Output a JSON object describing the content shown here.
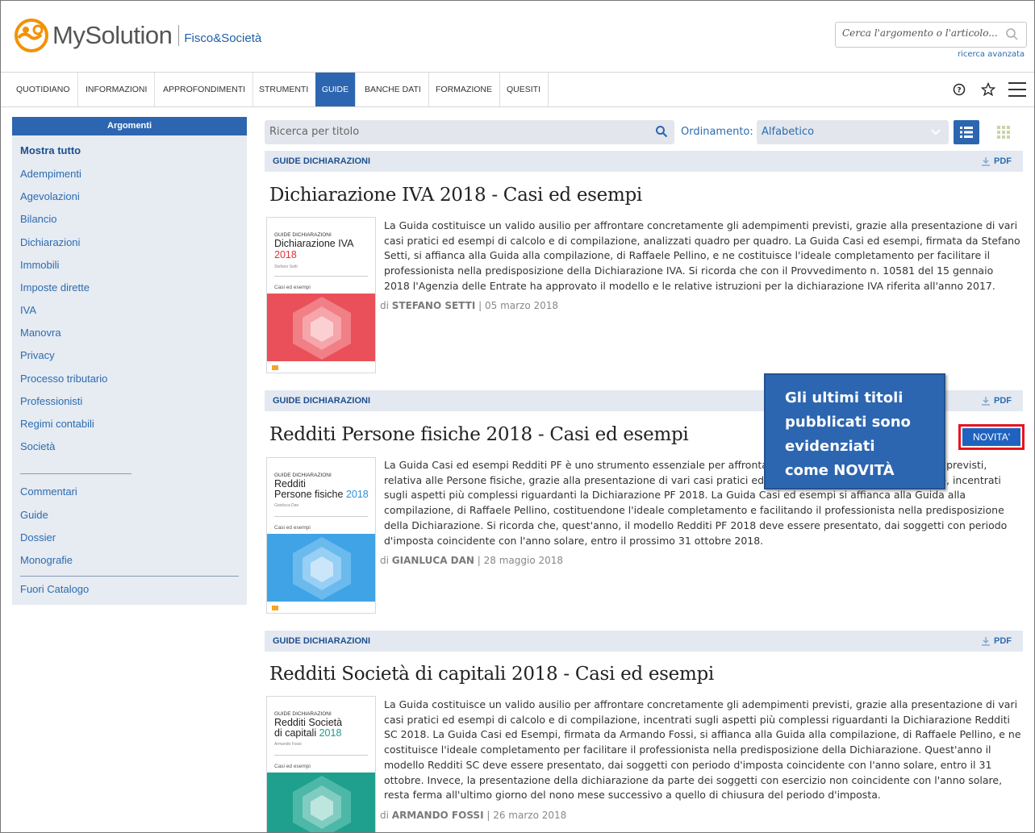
{
  "brand": {
    "name": "MySolution",
    "sub": "Fisco&Società"
  },
  "search": {
    "placeholder": "Cerca l'argomento o l'articolo...",
    "advanced": "ricerca avanzata"
  },
  "nav": {
    "items": [
      "QUOTIDIANO",
      "INFORMAZIONI",
      "APPROFONDIMENTI",
      "STRUMENTI",
      "GUIDE",
      "BANCHE DATI",
      "FORMAZIONE",
      "QUESITI"
    ],
    "active": "GUIDE"
  },
  "sidebar": {
    "title": "Argomenti",
    "items": [
      "Mostra tutto",
      "Adempimenti",
      "Agevolazioni",
      "Bilancio",
      "Dichiarazioni",
      "Immobili",
      "Imposte dirette",
      "IVA",
      "Manovra",
      "Privacy",
      "Processo tributario",
      "Professionisti",
      "Regimi contabili",
      "Società"
    ],
    "items2": [
      "Commentari",
      "Guide",
      "Dossier",
      "Monografie"
    ],
    "extra": "Fuori Catalogo"
  },
  "toolbar": {
    "title_placeholder": "Ricerca per titolo",
    "order_label": "Ordinamento:",
    "order_value": "Alfabetico"
  },
  "articles": [
    {
      "category": "GUIDE DICHIARAZIONI",
      "pdf": "PDF",
      "title": "Dichiarazione IVA 2018 - Casi ed esempi",
      "cover": {
        "kicker": "GUIDE DICHIARAZIONI",
        "title": "Dichiarazione IVA",
        "year": "2018",
        "author": "Stefano Setti",
        "sub": "Casi ed esempi",
        "color": "#e9505a",
        "year_color": "#e0323c"
      },
      "body": "La Guida costituisce un valido ausilio per affrontare concretamente gli adempimenti previsti, grazie alla presentazione di vari casi pratici ed esempi di calcolo e di compilazione, analizzati quadro per quadro. La Guida Casi ed esempi, firmata da Stefano Setti, si affianca alla Guida alla compilazione, di Raffaele Pellino, e ne costituisce l'ideale completamento per facilitare il professionista nella predisposizione della Dichiarazione IVA. Si ricorda che con il Provvedimento n. 10581 del 15 gennaio 2018 l'Agenzia delle Entrate ha approvato il modello e le relative istruzioni per la dichiarazione IVA riferita all'anno 2017.",
      "by": "di",
      "author": "STEFANO SETTI",
      "date": "| 05 marzo 2018"
    },
    {
      "category": "GUIDE DICHIARAZIONI",
      "pdf": "PDF",
      "title": "Redditi Persone fisiche 2018 - Casi ed esempi",
      "badge": "NOVITA'",
      "cover": {
        "kicker": "GUIDE DICHIARAZIONI",
        "title": "Redditi",
        "title2": "Persone fisiche",
        "year": "2018",
        "author": "Gianluca Dan",
        "sub": "Casi ed esempi",
        "color": "#3fa3e6",
        "year_color": "#2f8fd8"
      },
      "body": "La Guida Casi ed esempi Redditi PF è uno strumento essenziale per affrontare concretamente gli adempimenti previsti, relativa alle Persone fisiche, grazie alla presentazione di vari casi pratici ed esempi di calcolo e di compilazione, incentrati sugli aspetti più complessi riguardanti la Dichiarazione PF 2018. La Guida Casi ed esempi si affianca alla Guida alla compilazione, di Raffaele Pellino, costituendone l'ideale completamento e facilitando il professionista nella predisposizione della Dichiarazione. Si ricorda che, quest'anno, il modello Redditi PF 2018 deve essere presentato, dai soggetti con periodo d'imposta coincidente con l'anno solare, entro il prossimo 31 ottobre 2018.",
      "by": "di",
      "author": "GIANLUCA DAN",
      "date": "| 28 maggio 2018"
    },
    {
      "category": "GUIDE DICHIARAZIONI",
      "pdf": "PDF",
      "title": "Redditi Società di capitali 2018 - Casi ed esempi",
      "cover": {
        "kicker": "GUIDE DICHIARAZIONI",
        "title": "Redditi Società",
        "title2": "di capitali",
        "year": "2018",
        "author": "Armando Fossi",
        "sub": "Casi ed esempi",
        "color": "#1fa08e",
        "year_color": "#16a085"
      },
      "body": "La Guida costituisce un valido ausilio per affrontare concretamente gli adempimenti previsti, grazie alla presentazione di vari casi pratici ed esempi di calcolo e di compilazione, incentrati sugli aspetti più complessi riguardanti la Dichiarazione Redditi SC 2018. La Guida Casi ed Esempi, firmata da Armando Fossi, si affianca alla Guida alla compilazione, di Raffaele Pellino, e ne costituisce l'ideale completamento per facilitare il professionista nella predisposizione della Dichiarazione. Quest'anno il modello Redditi SC deve essere presentato, dai soggetti con periodo d'imposta coincidente con l'anno solare, entro il 31 ottobre. Invece, la presentazione della dichiarazione da parte dei soggetti con esercizio non coincidente con l'anno solare, resta ferma all'ultimo giorno del nono mese successivo a quello di chiusura del periodo d'imposta.",
      "by": "di",
      "author": "ARMANDO FOSSI",
      "date": "| 26 marzo 2018"
    }
  ],
  "callout": {
    "lines": [
      "Gli ultimi titoli",
      "pubblicati sono",
      "evidenziati",
      "come NOVITÀ"
    ]
  },
  "colors": {
    "brand_blue": "#2d66b0",
    "link": "#2b6cb0",
    "logo_orange": "#f39200",
    "badge_border": "#e8141e"
  }
}
